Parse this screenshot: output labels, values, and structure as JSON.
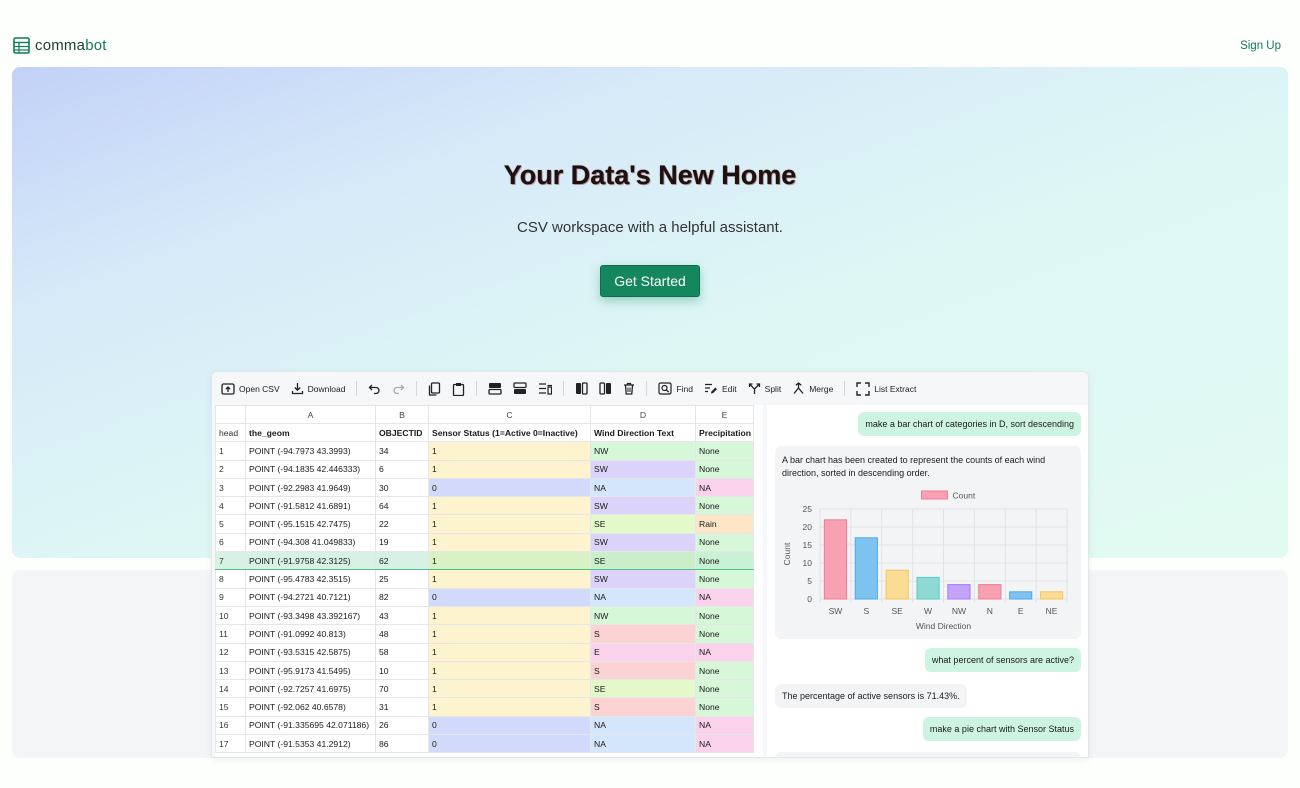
{
  "brand": {
    "name_part1": "comma",
    "name_part2": "bot"
  },
  "nav": {
    "signup": "Sign Up"
  },
  "hero": {
    "title": "Your Data's New Home",
    "subtitle": "CSV workspace with a helpful assistant.",
    "cta": "Get Started"
  },
  "toolbar": {
    "open_csv": "Open CSV",
    "download": "Download",
    "find": "Find",
    "edit": "Edit",
    "split": "Split",
    "merge": "Merge",
    "list_extract": "List Extract"
  },
  "grid": {
    "col_letters": [
      "A",
      "B",
      "C",
      "D",
      "E"
    ],
    "header_label": "head",
    "headers": [
      "the_geom",
      "OBJECTID",
      "Sensor Status (1=Active 0=Inactive)",
      "Wind Direction Text",
      "Precipitation"
    ],
    "rows": [
      [
        "1",
        "POINT (-94.7973 43.3993)",
        "34",
        "1",
        "NW",
        "None"
      ],
      [
        "2",
        "POINT (-94.1835 42.446333)",
        "6",
        "1",
        "SW",
        "None"
      ],
      [
        "3",
        "POINT (-92.2983 41.9649)",
        "30",
        "0",
        "NA",
        "NA"
      ],
      [
        "4",
        "POINT (-91.5812 41.6891)",
        "64",
        "1",
        "SW",
        "None"
      ],
      [
        "5",
        "POINT (-95.1515 42.7475)",
        "22",
        "1",
        "SE",
        "Rain"
      ],
      [
        "6",
        "POINT (-94.308 41.049833)",
        "19",
        "1",
        "SW",
        "None"
      ],
      [
        "7",
        "POINT (-91.9758 42.3125)",
        "62",
        "1",
        "SE",
        "None"
      ],
      [
        "8",
        "POINT (-95.4783 42.3515)",
        "25",
        "1",
        "SW",
        "None"
      ],
      [
        "9",
        "POINT (-94.2721 40.7121)",
        "82",
        "0",
        "NA",
        "NA"
      ],
      [
        "10",
        "POINT (-93.3498 43.392167)",
        "43",
        "1",
        "NW",
        "None"
      ],
      [
        "11",
        "POINT (-91.0992 40.813)",
        "48",
        "1",
        "S",
        "None"
      ],
      [
        "12",
        "POINT (-93.5315 42.5875)",
        "58",
        "1",
        "E",
        "NA"
      ],
      [
        "13",
        "POINT (-95.9173 41.5495)",
        "10",
        "1",
        "S",
        "None"
      ],
      [
        "14",
        "POINT (-92.7257 41.6975)",
        "70",
        "1",
        "SE",
        "None"
      ],
      [
        "15",
        "POINT (-92.062 40.6578)",
        "31",
        "1",
        "S",
        "None"
      ],
      [
        "16",
        "POINT (-91.335695 42.071186)",
        "26",
        "0",
        "NA",
        "NA"
      ],
      [
        "17",
        "POINT (-91.5353 41.2912)",
        "86",
        "0",
        "NA",
        "NA"
      ]
    ],
    "selected_row": "7",
    "colors": {
      "yellow": "#fdf4cf",
      "blue": "#d1dafa",
      "green": "#d6f8d9",
      "purple": "#dcd3fa",
      "red": "#fbd3d3",
      "pink": "#fbd2ec",
      "light": "#d3e6fb",
      "lime": "#e4f9c9",
      "orange": "#fde6c8"
    }
  },
  "chat": {
    "msg1": "make a bar chart of categories in D, sort descending",
    "bot1": "A bar chart has been created to represent the counts of each wind direction, sorted in descending order.",
    "msg2": "what percent of sensors are active?",
    "bot2": "The percentage of active sensors is 71.43%.",
    "msg3": "make a pie chart with Sensor Status"
  },
  "chart_data": {
    "type": "bar",
    "categories": [
      "SW",
      "S",
      "SE",
      "W",
      "NW",
      "N",
      "E",
      "NE"
    ],
    "series": [
      {
        "name": "Count",
        "values": [
          22,
          17,
          8,
          6,
          4,
          4,
          2,
          2
        ]
      }
    ],
    "title": "",
    "xlabel": "Wind Direction",
    "ylabel": "Count",
    "ylim": [
      0,
      25
    ],
    "yticks": [
      0,
      5,
      10,
      15,
      20,
      25
    ],
    "grid": true,
    "legend": "top",
    "colors": [
      "#f7a1b3",
      "#7ec3ef",
      "#fbdc95",
      "#8fd9d5",
      "#c4a4fa",
      "#f7a1b3",
      "#7ec3ef",
      "#fbdc95"
    ],
    "edge_colors": [
      "#f07b95",
      "#4fa9e8",
      "#f6c45c",
      "#5cc9c2",
      "#a37cf7",
      "#f07b95",
      "#4fa9e8",
      "#f6c45c"
    ]
  }
}
